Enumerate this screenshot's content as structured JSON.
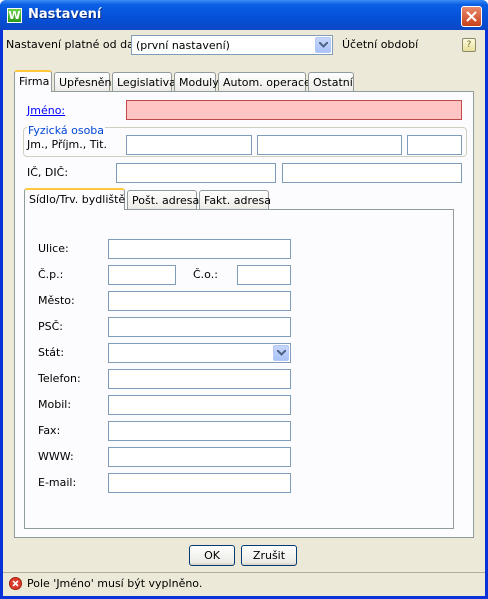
{
  "window": {
    "title": "Nastavení",
    "app_icon_letter": "W"
  },
  "top": {
    "valid_from_label": "Nastavení platné od data:",
    "valid_from_value": "(první nastavení)",
    "period_label": "Účetní období"
  },
  "tabs": [
    "Firma",
    "Upřesnění",
    "Legislativa",
    "Moduly",
    "Autom. operace",
    "Ostatní"
  ],
  "firma": {
    "name_label": "Jméno:",
    "person_group_title": "Fyzická osoba",
    "person_fields_label": "Jm., Příjm., Tit.",
    "ic_dic_label": "IČ, DIČ:"
  },
  "address_tabs": [
    "Sídlo/Trv. bydliště",
    "Pošt. adresa",
    "Fakt. adresa"
  ],
  "address": {
    "ulice": "Ulice:",
    "cp": "Č.p.:",
    "co": "Č.o.:",
    "mesto": "Město:",
    "psc": "PSČ:",
    "stat": "Stát:",
    "stat_value": "",
    "telefon": "Telefon:",
    "mobil": "Mobil:",
    "fax": "Fax:",
    "www": "WWW:",
    "email": "E-mail:"
  },
  "buttons": {
    "ok": "OK",
    "cancel": "Zrušit"
  },
  "status": {
    "message": "Pole 'Jméno' musí být vyplněno."
  },
  "colors": {
    "error_field": "#ffc4c4",
    "active_tab_accent": "#ffc73c",
    "link": "#0000ff"
  }
}
